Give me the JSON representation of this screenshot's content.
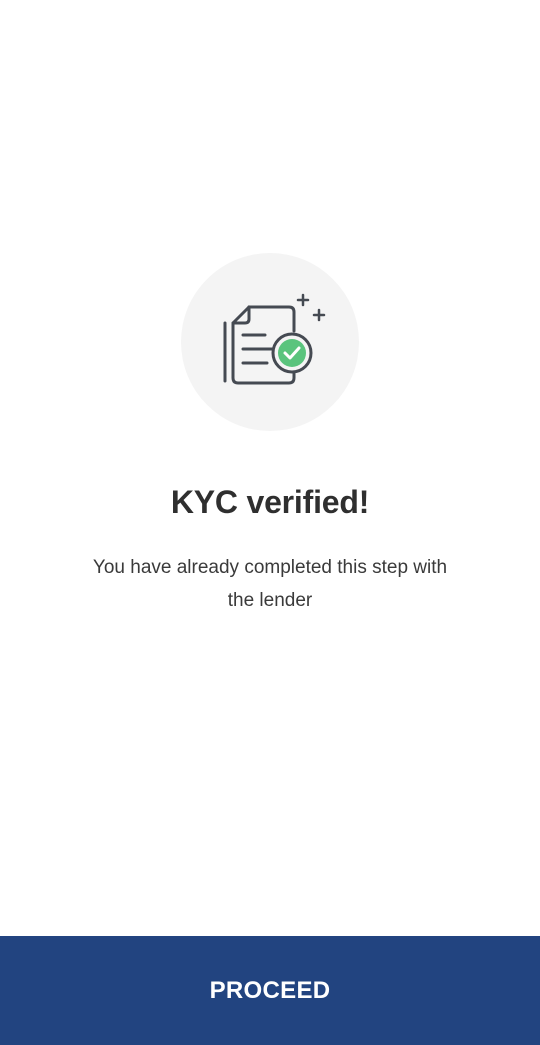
{
  "status": {
    "icon": "kyc-document-verified-icon",
    "title": "KYC verified!",
    "message": "You have already completed this step with the lender"
  },
  "footer": {
    "proceed_label": "PROCEED"
  },
  "colors": {
    "primary": "#224480",
    "success": "#5ac47d",
    "icon_stroke": "#454a52",
    "icon_bg": "#f4f4f4"
  }
}
